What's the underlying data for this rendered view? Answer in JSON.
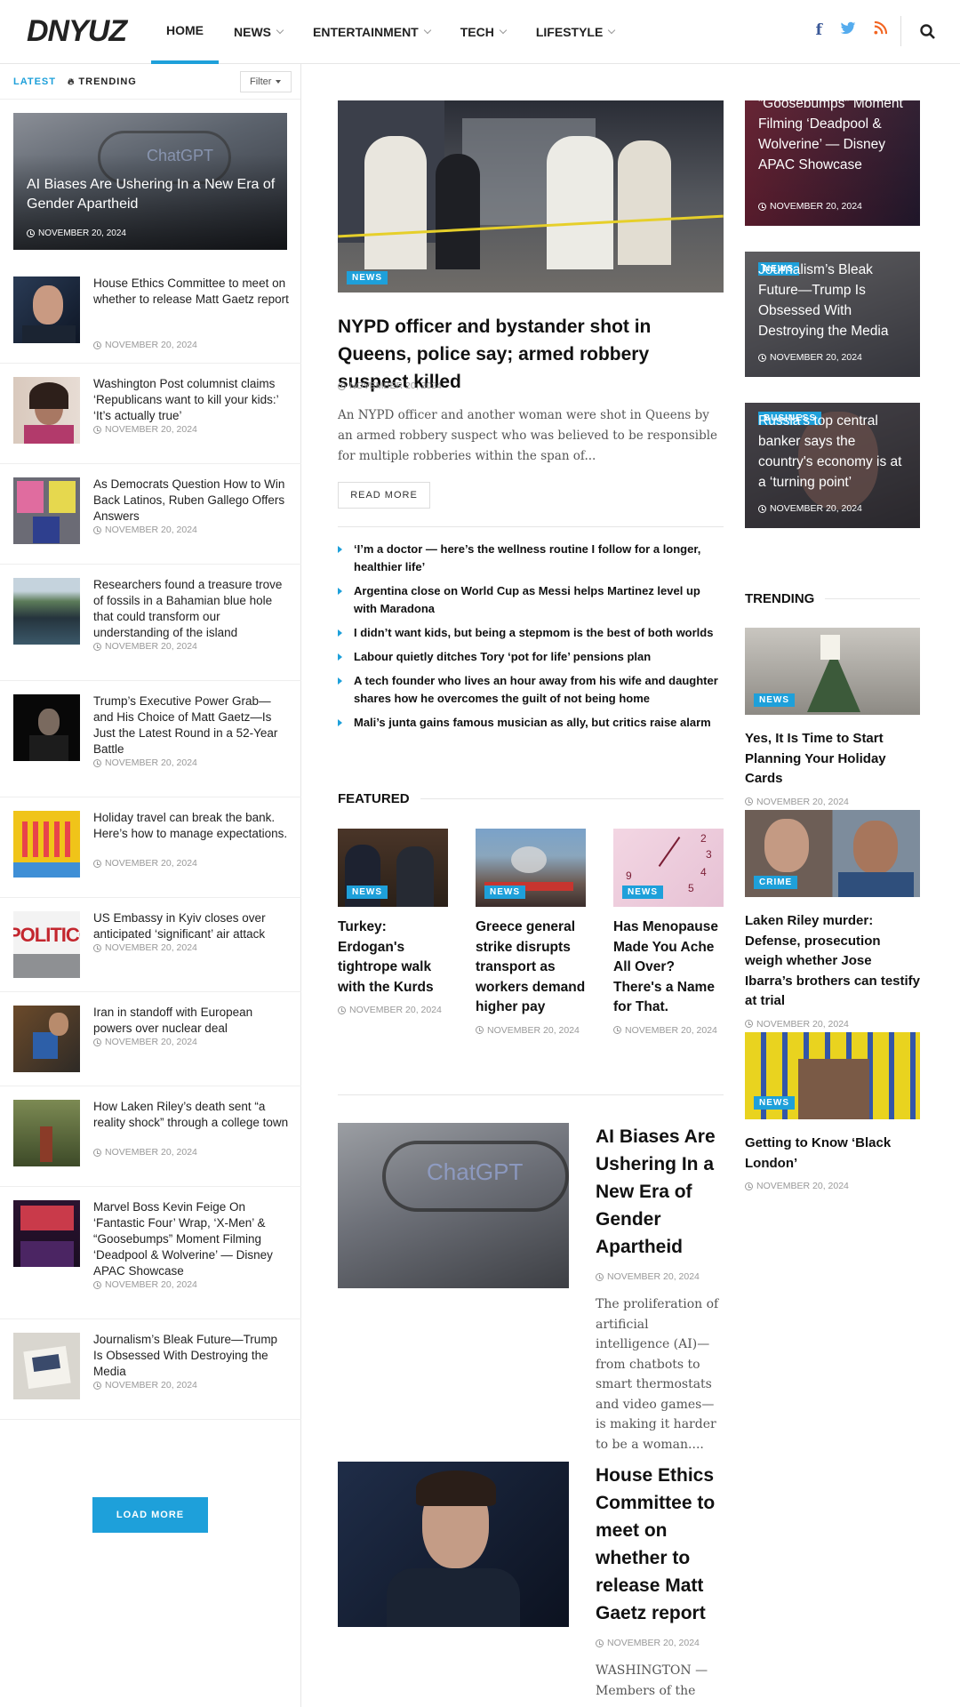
{
  "site": {
    "logo": "DNYUZ"
  },
  "nav": {
    "items": [
      {
        "label": "HOME"
      },
      {
        "label": "NEWS"
      },
      {
        "label": "ENTERTAINMENT"
      },
      {
        "label": "TECH"
      },
      {
        "label": "LIFESTYLE"
      }
    ]
  },
  "social": {
    "facebook": "f",
    "facebook_color": "#3b5998",
    "twitter_color": "#55acee",
    "rss_color": "#f26522"
  },
  "accent_color": "#1ea0da",
  "sidebar": {
    "tabs": {
      "latest": "LATEST",
      "trending": "TRENDING"
    },
    "filter": "Filter",
    "feature": {
      "title": "AI Biases Are Ushering In a New Era of Gender Apartheid",
      "date": "NOVEMBER 20, 2024"
    },
    "items": [
      {
        "title": "House Ethics Committee to meet on whether to release Matt Gaetz report",
        "date": "NOVEMBER 20, 2024"
      },
      {
        "title": "Washington Post columnist claims ‘Republicans want to kill your kids:’ ‘It’s actually true’",
        "date": "NOVEMBER 20, 2024"
      },
      {
        "title": "As Democrats Question How to Win Back Latinos, Ruben Gallego Offers Answers",
        "date": "NOVEMBER 20, 2024"
      },
      {
        "title": "Researchers found a treasure trove of fossils in a Bahamian blue hole that could transform our understanding of the island",
        "date": "NOVEMBER 20, 2024"
      },
      {
        "title": "Trump’s Executive Power Grab—and His Choice of Matt Gaetz—Is Just the Latest Round in a 52-Year Battle",
        "date": "NOVEMBER 20, 2024"
      },
      {
        "title": "Holiday travel can break the bank. Here’s how to manage expectations.",
        "date": "NOVEMBER 20, 2024"
      },
      {
        "title": "US Embassy in Kyiv closes over anticipated ‘significant’ air attack",
        "date": "NOVEMBER 20, 2024"
      },
      {
        "title": "Iran in standoff with European powers over nuclear deal",
        "date": "NOVEMBER 20, 2024"
      },
      {
        "title": "How Laken Riley’s death sent “a reality shock” through a college town",
        "date": "NOVEMBER 20, 2024"
      },
      {
        "title": "Marvel Boss Kevin Feige On ‘Fantastic Four’ Wrap, ‘X-Men’ & “Goosebumps” Moment Filming ‘Deadpool & Wolverine’ — Disney APAC Showcase",
        "date": "NOVEMBER 20, 2024"
      },
      {
        "title": "Journalism’s Bleak Future—Trump Is Obsessed With Destroying the Media",
        "date": "NOVEMBER 20, 2024"
      }
    ],
    "thumb_texts": {
      "politico": "POLITICO"
    },
    "load_more": "LOAD MORE"
  },
  "main": {
    "hero": {
      "badge": "NEWS",
      "title": "NYPD officer and bystander shot in Queens, police say; armed robbery suspect killed",
      "date": "NOVEMBER 20, 2024",
      "excerpt": "An NYPD officer and another woman were shot in Queens by an armed robbery suspect who was believed to be responsible for multiple robberies within the span of...",
      "read_more": "READ MORE"
    },
    "bullets": [
      "‘I’m a doctor — here’s the wellness routine I follow for a longer, healthier life’",
      "Argentina close on World Cup as Messi helps Martinez level up with Maradona",
      "I didn’t want kids, but being a stepmom is the best of both worlds",
      "Labour quietly ditches Tory ‘pot for life’ pensions plan",
      "A tech founder who lives an hour away from his wife and daughter shares how he overcomes the guilt of not being home",
      "Mali’s junta gains famous musician as ally, but critics raise alarm"
    ],
    "featured": {
      "heading": "FEATURED",
      "items": [
        {
          "badge": "NEWS",
          "title": "Turkey: Erdogan's tightrope walk with the Kurds",
          "date": "NOVEMBER 20, 2024"
        },
        {
          "badge": "NEWS",
          "title": "Greece general strike disrupts transport as workers demand higher pay",
          "date": "NOVEMBER 20, 2024"
        },
        {
          "badge": "NEWS",
          "title": "Has Menopause Made You Ache All Over? There's a Name for That.",
          "date": "NOVEMBER 20, 2024"
        }
      ]
    },
    "list": [
      {
        "title": "AI Biases Are Ushering In a New Era of Gender Apartheid",
        "date": "NOVEMBER 20, 2024",
        "excerpt": "The proliferation of artificial intelligence (AI)—from chatbots to smart thermostats and video games—is making it harder to be a woman...."
      },
      {
        "title": "House Ethics Committee to meet on whether to release Matt Gaetz report",
        "date": "NOVEMBER 20, 2024",
        "excerpt": "WASHINGTON — Members of the"
      }
    ]
  },
  "right": {
    "cards": [
      {
        "title": "“Goosebumps” Moment Filming ‘Deadpool & Wolverine’ — Disney APAC Showcase",
        "date": "NOVEMBER 20, 2024"
      },
      {
        "badge": "NEWS",
        "title": "Journalism’s Bleak Future—Trump Is Obsessed With Destroying the Media",
        "date": "NOVEMBER 20, 2024"
      },
      {
        "badge": "BUSINESS",
        "title": "Russia's top central banker says the country's economy is at a ‘turning point’",
        "date": "NOVEMBER 20, 2024"
      }
    ],
    "trending_heading": "TRENDING",
    "trending": [
      {
        "badge": "NEWS",
        "title": "Yes, It Is Time to Start Planning Your Holiday Cards",
        "date": "NOVEMBER 20, 2024"
      },
      {
        "badge": "CRIME",
        "title": "Laken Riley murder: Defense, prosecution weigh whether Jose Ibarra’s brothers can testify at trial",
        "date": "NOVEMBER 20, 2024"
      },
      {
        "badge": "NEWS",
        "title": "Getting to Know ‘Black London’",
        "date": "NOVEMBER 20, 2024"
      }
    ]
  }
}
